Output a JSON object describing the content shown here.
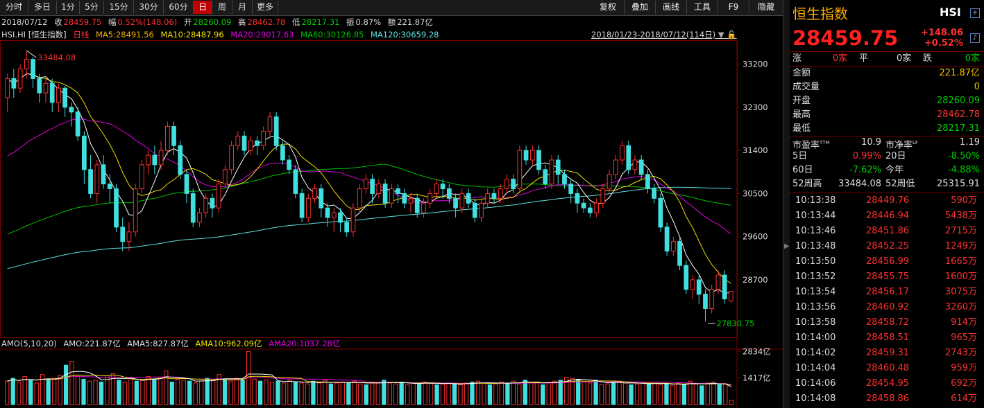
{
  "toolbar": {
    "periods": [
      "分时",
      "多日",
      "1分",
      "5分",
      "15分",
      "30分",
      "60分",
      "日",
      "周",
      "月",
      "更多"
    ],
    "active": "日",
    "right_buttons": [
      "复权",
      "叠加",
      "画线",
      "工具",
      "F9",
      "隐藏"
    ]
  },
  "info": {
    "date": "2018/07/12",
    "close_label": "收",
    "close": "28459.75",
    "change_label": "幅",
    "change": "0.52%(148.06)",
    "open_label": "开",
    "open": "28260.09",
    "high_label": "高",
    "high": "28462.78",
    "low_label": "低",
    "low": "28217.31",
    "amp_label": "振",
    "amp": "0.87%",
    "amount_label": "额",
    "amount": "221.87亿"
  },
  "ma": {
    "name": "HSI.HI [恒生指数]",
    "period": "日线",
    "ma5": "MA5:28491.56",
    "ma10": "MA10:28487.96",
    "ma20": "MA20:29017.63",
    "ma60": "MA60:30126.85",
    "ma120": "MA120:30659.28",
    "range": "2018/01/23-2018/07/12(114日)"
  },
  "amo": {
    "label": "AMO(5,10,20)",
    "amo": "AMO:221.87亿",
    "ama5": "AMA5:827.87亿",
    "ama10": "AMA10:962.09亿",
    "ama20": "AMA20:1037.28亿"
  },
  "chart_data": {
    "type": "candlestick",
    "y_ticks": [
      "33200",
      "32300",
      "31400",
      "30500",
      "29600",
      "28700"
    ],
    "ylim": [
      27500,
      33700
    ],
    "annotations": {
      "high": "33484.08",
      "low": "27830.75"
    },
    "vol_ticks": [
      "2834亿",
      "1417亿"
    ],
    "colors": {
      "up": "#ff3030",
      "down": "#40e0e0",
      "ma5": "#ffffff",
      "ma10": "#f0e000",
      "ma20": "#e000e0",
      "ma60": "#00c000",
      "ma120": "#60e0e0"
    },
    "candles": [
      [
        32500,
        32900,
        32200,
        33000
      ],
      [
        32900,
        32700,
        32500,
        33100
      ],
      [
        32700,
        33100,
        32600,
        33200
      ],
      [
        33100,
        33300,
        32900,
        33484.08
      ],
      [
        33300,
        32900,
        32700,
        33350
      ],
      [
        32900,
        32600,
        32400,
        33000
      ],
      [
        32600,
        32800,
        32400,
        32900
      ],
      [
        32800,
        32400,
        32200,
        32900
      ],
      [
        32400,
        32700,
        32200,
        32800
      ],
      [
        32700,
        32300,
        32100,
        32750
      ],
      [
        32300,
        32200,
        31900,
        32400
      ],
      [
        32200,
        31700,
        31600,
        32300
      ],
      [
        31700,
        31000,
        30700,
        31800
      ],
      [
        31000,
        30500,
        30400,
        31300
      ],
      [
        30500,
        31100,
        30300,
        31200
      ],
      [
        31100,
        30700,
        30600,
        31300
      ],
      [
        30700,
        30600,
        30300,
        30900
      ],
      [
        30600,
        29800,
        29700,
        30700
      ],
      [
        29800,
        29500,
        29300,
        30000
      ],
      [
        29500,
        29700,
        29300,
        29900
      ],
      [
        29700,
        30600,
        29600,
        30700
      ],
      [
        30600,
        31100,
        30500,
        31200
      ],
      [
        31100,
        31300,
        30900,
        31400
      ],
      [
        31300,
        31100,
        30900,
        31500
      ],
      [
        31100,
        31400,
        31000,
        31600
      ],
      [
        31400,
        31900,
        31300,
        32000
      ],
      [
        31900,
        31500,
        31300,
        32000
      ],
      [
        31500,
        30900,
        30800,
        31600
      ],
      [
        30900,
        30500,
        30300,
        31000
      ],
      [
        30500,
        29900,
        29800,
        30600
      ],
      [
        29900,
        30100,
        29800,
        30200
      ],
      [
        30100,
        30400,
        30000,
        30500
      ],
      [
        30400,
        30200,
        30000,
        30500
      ],
      [
        30200,
        30700,
        30100,
        30800
      ],
      [
        30700,
        31000,
        30600,
        31100
      ],
      [
        31000,
        31500,
        30900,
        31600
      ],
      [
        31500,
        31700,
        31400,
        31800
      ],
      [
        31700,
        31400,
        31300,
        31800
      ],
      [
        31400,
        31600,
        31300,
        31700
      ],
      [
        31600,
        31500,
        31300,
        31700
      ],
      [
        31500,
        31800,
        31400,
        31900
      ],
      [
        31800,
        32100,
        31700,
        32200
      ],
      [
        32100,
        31500,
        31400,
        32200
      ],
      [
        31500,
        31200,
        31100,
        31600
      ],
      [
        31200,
        31000,
        30900,
        31300
      ],
      [
        31000,
        30500,
        30400,
        31100
      ],
      [
        30500,
        30000,
        29900,
        30600
      ],
      [
        30000,
        30400,
        29900,
        30500
      ],
      [
        30400,
        30600,
        30300,
        30700
      ],
      [
        30600,
        30200,
        30000,
        30700
      ],
      [
        30200,
        30000,
        29800,
        30300
      ],
      [
        30000,
        30100,
        29700,
        30200
      ],
      [
        30100,
        29900,
        29700,
        30200
      ],
      [
        29900,
        29700,
        29600,
        30000
      ],
      [
        29700,
        30200,
        29600,
        30300
      ],
      [
        30200,
        30600,
        30100,
        30700
      ],
      [
        30600,
        30800,
        30500,
        30900
      ],
      [
        30800,
        30500,
        30300,
        30900
      ],
      [
        30500,
        30700,
        30400,
        30800
      ],
      [
        30700,
        30300,
        30200,
        30800
      ],
      [
        30300,
        30600,
        30200,
        30700
      ],
      [
        30600,
        30500,
        30300,
        30700
      ],
      [
        30500,
        30300,
        30200,
        30600
      ],
      [
        30300,
        30400,
        30100,
        30500
      ],
      [
        30400,
        30100,
        30000,
        30500
      ],
      [
        30100,
        30300,
        30000,
        30400
      ],
      [
        30300,
        30500,
        30200,
        30600
      ],
      [
        30500,
        30700,
        30400,
        30800
      ],
      [
        30700,
        30600,
        30400,
        30800
      ],
      [
        30600,
        30400,
        30300,
        30700
      ],
      [
        30400,
        30200,
        30000,
        30500
      ],
      [
        30200,
        30500,
        30100,
        30600
      ],
      [
        30500,
        30300,
        30200,
        30600
      ],
      [
        30300,
        30000,
        29900,
        30400
      ],
      [
        30000,
        30300,
        29900,
        30400
      ],
      [
        30300,
        30500,
        30200,
        30600
      ],
      [
        30500,
        30400,
        30300,
        30600
      ],
      [
        30400,
        30600,
        30300,
        30700
      ],
      [
        30600,
        30800,
        30500,
        30900
      ],
      [
        30800,
        30600,
        30500,
        30900
      ],
      [
        30600,
        31400,
        30500,
        31500
      ],
      [
        31400,
        31200,
        31100,
        31500
      ],
      [
        31200,
        31400,
        31100,
        31500
      ],
      [
        31400,
        31000,
        30900,
        31500
      ],
      [
        31000,
        30700,
        30600,
        31100
      ],
      [
        30700,
        31200,
        30600,
        31300
      ],
      [
        31200,
        30900,
        30700,
        31300
      ],
      [
        30900,
        30700,
        30600,
        31000
      ],
      [
        30700,
        30500,
        30300,
        30800
      ],
      [
        30500,
        30300,
        30100,
        30600
      ],
      [
        30300,
        30200,
        30100,
        30400
      ],
      [
        30200,
        30100,
        30000,
        30300
      ],
      [
        30100,
        30300,
        30000,
        30400
      ],
      [
        30300,
        30600,
        30200,
        30700
      ],
      [
        30600,
        30900,
        30500,
        31000
      ],
      [
        30900,
        31200,
        30800,
        31300
      ],
      [
        31200,
        31500,
        31100,
        31600
      ],
      [
        31500,
        31000,
        30900,
        31600
      ],
      [
        31000,
        31200,
        30900,
        31300
      ],
      [
        31200,
        30900,
        30800,
        31300
      ],
      [
        30900,
        30600,
        30500,
        31000
      ],
      [
        30600,
        30400,
        30300,
        30700
      ],
      [
        30400,
        29800,
        29700,
        30500
      ],
      [
        29800,
        29300,
        29200,
        29900
      ],
      [
        29300,
        29500,
        29200,
        29600
      ],
      [
        29500,
        29000,
        28900,
        29600
      ],
      [
        29000,
        28500,
        28400,
        29100
      ],
      [
        28500,
        28700,
        28300,
        28800
      ],
      [
        28700,
        28400,
        28200,
        28800
      ],
      [
        28400,
        28100,
        27830.75,
        28500
      ],
      [
        28100,
        28500,
        28000,
        28600
      ],
      [
        28500,
        28800,
        28400,
        28900
      ],
      [
        28800,
        28300,
        28200,
        28900
      ],
      [
        28260,
        28459.75,
        28217,
        28462
      ]
    ],
    "volumes": [
      1250,
      1400,
      1200,
      1500,
      1300,
      1150,
      1600,
      1350,
      1400,
      1550,
      2100,
      2300,
      1500,
      1350,
      1250,
      1300,
      1200,
      1550,
      1650,
      1300,
      1200,
      1400,
      1250,
      1300,
      1500,
      1350,
      1450,
      1800,
      1200,
      1350,
      1300,
      1250,
      1150,
      1250,
      1400,
      1300,
      1600,
      1350,
      1250,
      1400,
      1300,
      2834,
      1350,
      1250,
      1300,
      1200,
      1250,
      1150,
      1300,
      1200,
      1150,
      1100,
      1250,
      1150,
      1300,
      1100,
      1150,
      1200,
      1150,
      1250,
      1100,
      1050,
      1200,
      1150,
      1300,
      1150,
      1100,
      1200,
      1050,
      1150,
      1100,
      1200,
      1150,
      1050,
      1100,
      1150,
      1100,
      1050,
      1150,
      1200,
      1250,
      1150,
      1050,
      1100,
      1200,
      1150,
      1250,
      1100,
      1300,
      1150,
      1200,
      1050,
      1150,
      1250,
      1300,
      1450,
      1400,
      1350,
      1200,
      1150,
      1300,
      1050,
      1100,
      1250,
      1200,
      1150,
      1050,
      1100,
      1150,
      1100,
      1200,
      1050,
      1100,
      1000,
      1150,
      1050,
      1250,
      1100,
      1000,
      1150,
      1200,
      1050,
      1100,
      221
    ]
  },
  "panel": {
    "title": "恒生指数",
    "code": "HSI",
    "price": "28459.75",
    "change": "+148.06",
    "change_pct": "+0.52%",
    "breadth": {
      "up_label": "涨",
      "up": "0家",
      "flat_label": "平",
      "flat": "0家",
      "down_label": "跌",
      "down": "0家"
    },
    "stats": [
      {
        "label": "金额",
        "value": "221.87亿",
        "color": "yellow"
      },
      {
        "label": "成交量",
        "value": "0",
        "color": "yellow"
      },
      {
        "label": "开盘",
        "value": "28260.09",
        "color": "green"
      },
      {
        "label": "最高",
        "value": "28462.78",
        "color": "red"
      },
      {
        "label": "最低",
        "value": "28217.31",
        "color": "green"
      }
    ],
    "ratios": {
      "pe_label": "市盈率",
      "pe_sup": "TTM",
      "pe": "10.9",
      "pb_label": "市净率",
      "pb_sup": "LF",
      "pb": "1.19",
      "d5_label": "5日",
      "d5": "0.99%",
      "d20_label": "20日",
      "d20": "-8.50%",
      "d60_label": "60日",
      "d60": "-7.62%",
      "ytd_label": "今年",
      "ytd": "-4.88%",
      "hi52_label": "52周高",
      "hi52": "33484.08",
      "lo52_label": "52周低",
      "lo52": "25315.91"
    },
    "ticks": [
      {
        "time": "10:13:38",
        "price": "28449.76",
        "vol": "590万"
      },
      {
        "time": "10:13:44",
        "price": "28446.94",
        "vol": "5438万"
      },
      {
        "time": "10:13:46",
        "price": "28451.86",
        "vol": "2715万"
      },
      {
        "time": "10:13:48",
        "price": "28452.25",
        "vol": "1249万"
      },
      {
        "time": "10:13:50",
        "price": "28456.99",
        "vol": "1665万"
      },
      {
        "time": "10:13:52",
        "price": "28455.75",
        "vol": "1600万"
      },
      {
        "time": "10:13:54",
        "price": "28456.17",
        "vol": "3075万"
      },
      {
        "time": "10:13:56",
        "price": "28460.92",
        "vol": "3260万"
      },
      {
        "time": "10:13:58",
        "price": "28458.72",
        "vol": "914万"
      },
      {
        "time": "10:14:00",
        "price": "28458.51",
        "vol": "965万"
      },
      {
        "time": "10:14:02",
        "price": "28459.31",
        "vol": "2743万"
      },
      {
        "time": "10:14:04",
        "price": "28460.48",
        "vol": "959万"
      },
      {
        "time": "10:14:06",
        "price": "28454.95",
        "vol": "692万"
      },
      {
        "time": "10:14:08",
        "price": "28458.86",
        "vol": "614万"
      }
    ]
  }
}
